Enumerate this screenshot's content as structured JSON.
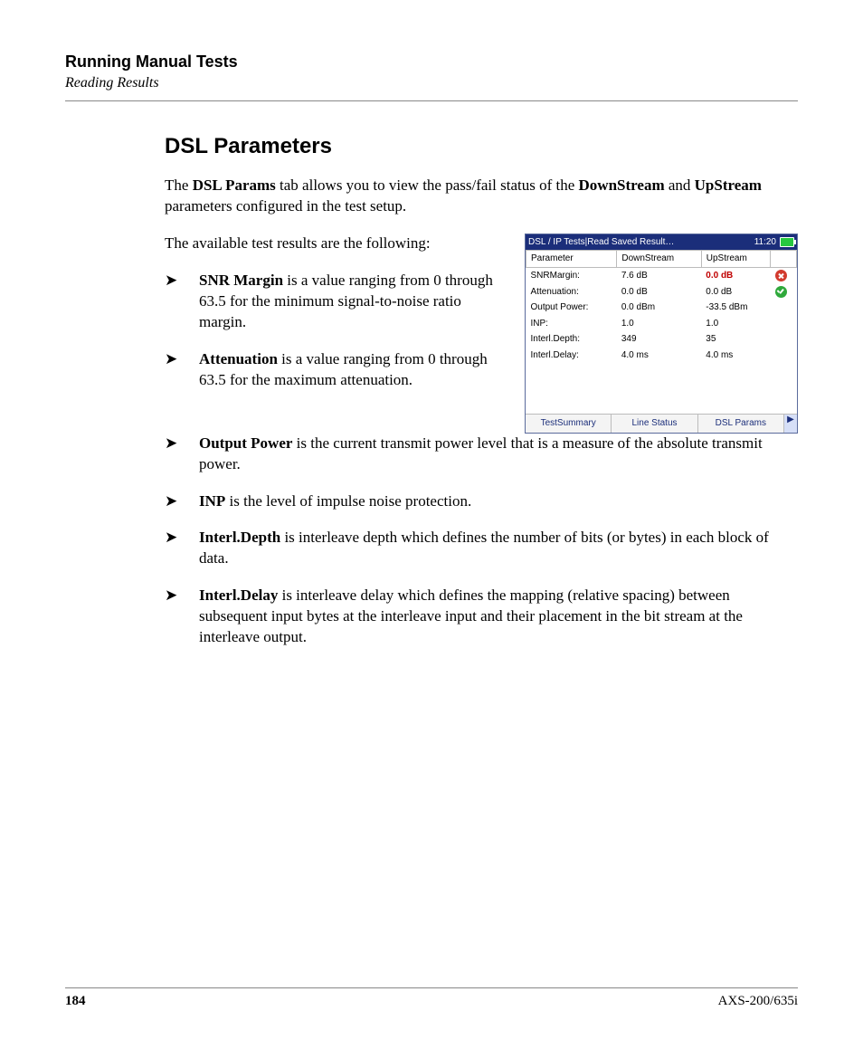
{
  "header": {
    "chapter": "Running Manual Tests",
    "section": "Reading Results"
  },
  "title": "DSL Parameters",
  "intro": {
    "p1_pre": "The ",
    "p1_b1": "DSL Params",
    "p1_mid": " tab allows you to view the pass/fail status of the ",
    "p1_b2": "DownStream",
    "p1_and": " and ",
    "p1_b3": "UpStream",
    "p1_post": " parameters configured in the test setup.",
    "p2": "The available test results are the following:"
  },
  "bullets": [
    {
      "b": "SNR Margin",
      "t": " is a value ranging from 0 through 63.5 for the minimum signal-to-noise ratio margin."
    },
    {
      "b": "Attenuation",
      "t": " is a value ranging from 0 through 63.5 for the maximum attenuation."
    },
    {
      "b": "Output Power",
      "t": " is the current transmit power level that is a measure of the absolute transmit power."
    },
    {
      "b": "INP",
      "t": " is the level of impulse noise protection."
    },
    {
      "b": "Interl.Depth",
      "t": " is interleave depth which defines the number of bits (or bytes) in each block of data."
    },
    {
      "b": "Interl.Delay",
      "t": " is interleave delay which defines the mapping (relative spacing) between subsequent input bytes at the interleave input and their placement in the bit stream at the interleave output."
    }
  ],
  "screenshot": {
    "title": "DSL / IP Tests|Read Saved Result…",
    "time": "11:20",
    "headers": {
      "param": "Parameter",
      "down": "DownStream",
      "up": "UpStream"
    },
    "rows": [
      {
        "param": "SNRMargin:",
        "down": "7.6  dB",
        "up": "0.0  dB",
        "up_fail": true,
        "status": "fail"
      },
      {
        "param": "Attenuation:",
        "down": "0.0  dB",
        "up": "0.0  dB",
        "status": "pass"
      },
      {
        "param": "Output Power:",
        "down": "0.0  dBm",
        "up": "-33.5  dBm"
      },
      {
        "param": "INP:",
        "down": "1.0",
        "up": "1.0"
      },
      {
        "param": "Interl.Depth:",
        "down": "349",
        "up": "35"
      },
      {
        "param": "Interl.Delay:",
        "down": "4.0 ms",
        "up": "4.0 ms"
      }
    ],
    "tabs": [
      "TestSummary",
      "Line Status",
      "DSL Params"
    ]
  },
  "footer": {
    "page": "184",
    "model": "AXS-200/635i"
  }
}
